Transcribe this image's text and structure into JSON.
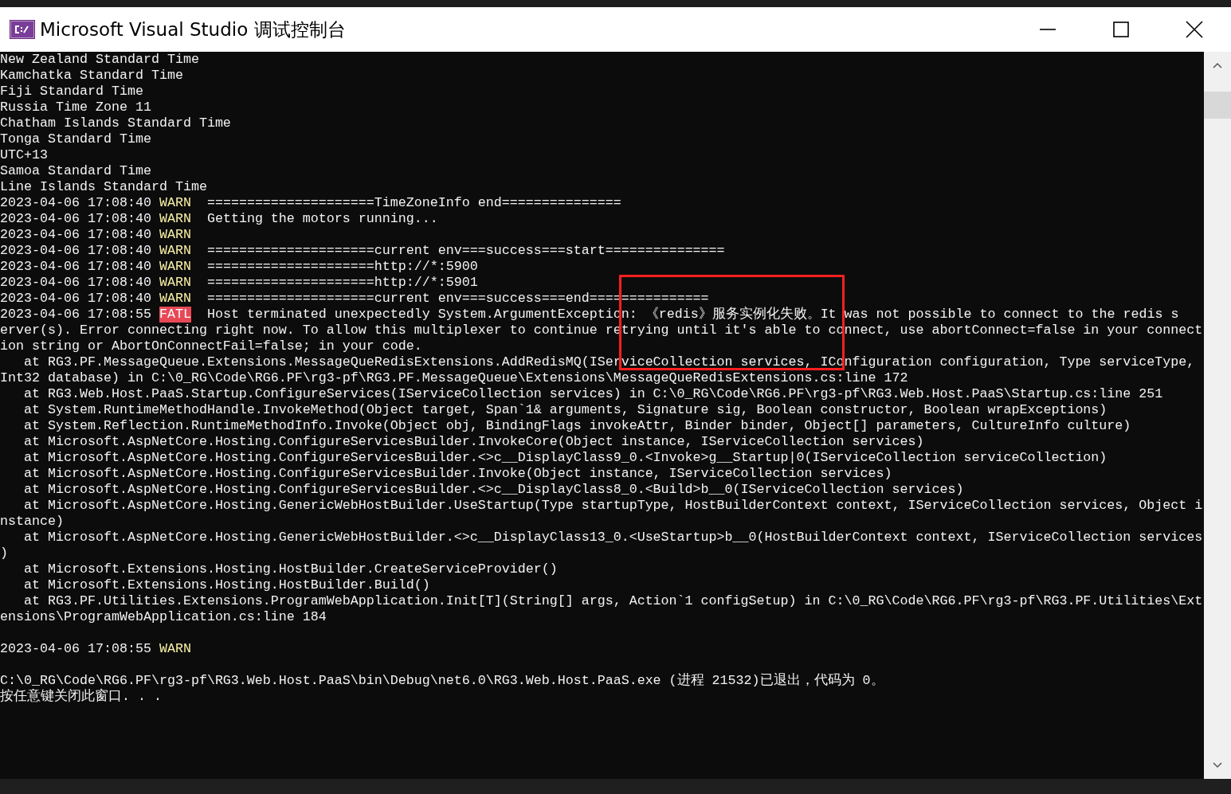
{
  "window": {
    "title": "Microsoft Visual Studio 调试控制台"
  },
  "console": {
    "lines": [
      {
        "kind": "text",
        "text": "New Zealand Standard Time"
      },
      {
        "kind": "text",
        "text": "Kamchatka Standard Time"
      },
      {
        "kind": "text",
        "text": "Fiji Standard Time"
      },
      {
        "kind": "text",
        "text": "Russia Time Zone 11"
      },
      {
        "kind": "text",
        "text": "Chatham Islands Standard Time"
      },
      {
        "kind": "text",
        "text": "Tonga Standard Time"
      },
      {
        "kind": "text",
        "text": "UTC+13"
      },
      {
        "kind": "text",
        "text": "Samoa Standard Time"
      },
      {
        "kind": "text",
        "text": "Line Islands Standard Time"
      },
      {
        "kind": "warn",
        "timestamp": "2023-04-06 17:08:40",
        "level": "WARN",
        "message": "=====================TimeZoneInfo end==============="
      },
      {
        "kind": "warn",
        "timestamp": "2023-04-06 17:08:40",
        "level": "WARN",
        "message": "Getting the motors running..."
      },
      {
        "kind": "warn",
        "timestamp": "2023-04-06 17:08:40",
        "level": "WARN"
      },
      {
        "kind": "warn",
        "timestamp": "2023-04-06 17:08:40",
        "level": "WARN",
        "message": "=====================current env===success===start==============="
      },
      {
        "kind": "warn",
        "timestamp": "2023-04-06 17:08:40",
        "level": "WARN",
        "message": "=====================http://*:5900"
      },
      {
        "kind": "warn",
        "timestamp": "2023-04-06 17:08:40",
        "level": "WARN",
        "message": "=====================http://*:5901"
      },
      {
        "kind": "warn",
        "timestamp": "2023-04-06 17:08:40",
        "level": "WARN",
        "message": "=====================current env===success===end==============="
      },
      {
        "kind": "fatal",
        "timestamp": "2023-04-06 17:08:55",
        "level": "FATL",
        "message": "Host terminated unexpectedly System.ArgumentException: 《redis》服务实例化失败。It was not possible to connect to the redis s"
      },
      {
        "kind": "text",
        "text": "erver(s). Error connecting right now. To allow this multiplexer to continue retrying until it's able to connect, use abortConnect=false in your connect"
      },
      {
        "kind": "text",
        "text": "ion string or AbortOnConnectFail=false; in your code."
      },
      {
        "kind": "text",
        "text": "   at RG3.PF.MessageQueue.Extensions.MessageQueRedisExtensions.AddRedisMQ(IServiceCollection services, IConfiguration configuration, Type serviceType,"
      },
      {
        "kind": "text",
        "text": "Int32 database) in C:\\0_RG\\Code\\RG6.PF\\rg3-pf\\RG3.PF.MessageQueue\\Extensions\\MessageQueRedisExtensions.cs:line 172"
      },
      {
        "kind": "text",
        "text": "   at RG3.Web.Host.PaaS.Startup.ConfigureServices(IServiceCollection services) in C:\\0_RG\\Code\\RG6.PF\\rg3-pf\\RG3.Web.Host.PaaS\\Startup.cs:line 251"
      },
      {
        "kind": "text",
        "text": "   at System.RuntimeMethodHandle.InvokeMethod(Object target, Span`1& arguments, Signature sig, Boolean constructor, Boolean wrapExceptions)"
      },
      {
        "kind": "text",
        "text": "   at System.Reflection.RuntimeMethodInfo.Invoke(Object obj, BindingFlags invokeAttr, Binder binder, Object[] parameters, CultureInfo culture)"
      },
      {
        "kind": "text",
        "text": "   at Microsoft.AspNetCore.Hosting.ConfigureServicesBuilder.InvokeCore(Object instance, IServiceCollection services)"
      },
      {
        "kind": "text",
        "text": "   at Microsoft.AspNetCore.Hosting.ConfigureServicesBuilder.<>c__DisplayClass9_0.<Invoke>g__Startup|0(IServiceCollection serviceCollection)"
      },
      {
        "kind": "text",
        "text": "   at Microsoft.AspNetCore.Hosting.ConfigureServicesBuilder.Invoke(Object instance, IServiceCollection services)"
      },
      {
        "kind": "text",
        "text": "   at Microsoft.AspNetCore.Hosting.ConfigureServicesBuilder.<>c__DisplayClass8_0.<Build>b__0(IServiceCollection services)"
      },
      {
        "kind": "text",
        "text": "   at Microsoft.AspNetCore.Hosting.GenericWebHostBuilder.UseStartup(Type startupType, HostBuilderContext context, IServiceCollection services, Object i"
      },
      {
        "kind": "text",
        "text": "nstance)"
      },
      {
        "kind": "text",
        "text": "   at Microsoft.AspNetCore.Hosting.GenericWebHostBuilder.<>c__DisplayClass13_0.<UseStartup>b__0(HostBuilderContext context, IServiceCollection services"
      },
      {
        "kind": "text",
        "text": ")"
      },
      {
        "kind": "text",
        "text": "   at Microsoft.Extensions.Hosting.HostBuilder.CreateServiceProvider()"
      },
      {
        "kind": "text",
        "text": "   at Microsoft.Extensions.Hosting.HostBuilder.Build()"
      },
      {
        "kind": "text",
        "text": "   at RG3.PF.Utilities.Extensions.ProgramWebApplication.Init[T](String[] args, Action`1 configSetup) in C:\\0_RG\\Code\\RG6.PF\\rg3-pf\\RG3.PF.Utilities\\Ext"
      },
      {
        "kind": "text",
        "text": "ensions\\ProgramWebApplication.cs:line 184"
      },
      {
        "kind": "blank"
      },
      {
        "kind": "warn",
        "timestamp": "2023-04-06 17:08:55",
        "level": "WARN"
      },
      {
        "kind": "blank"
      },
      {
        "kind": "text",
        "text": "C:\\0_RG\\Code\\RG6.PF\\rg3-pf\\RG3.Web.Host.PaaS\\bin\\Debug\\net6.0\\RG3.Web.Host.PaaS.exe (进程 21532)已退出，代码为 0。"
      },
      {
        "kind": "text",
        "text": "按任意键关闭此窗口. . ."
      }
    ]
  },
  "annotations": [
    {
      "kind": "rectangle"
    }
  ]
}
